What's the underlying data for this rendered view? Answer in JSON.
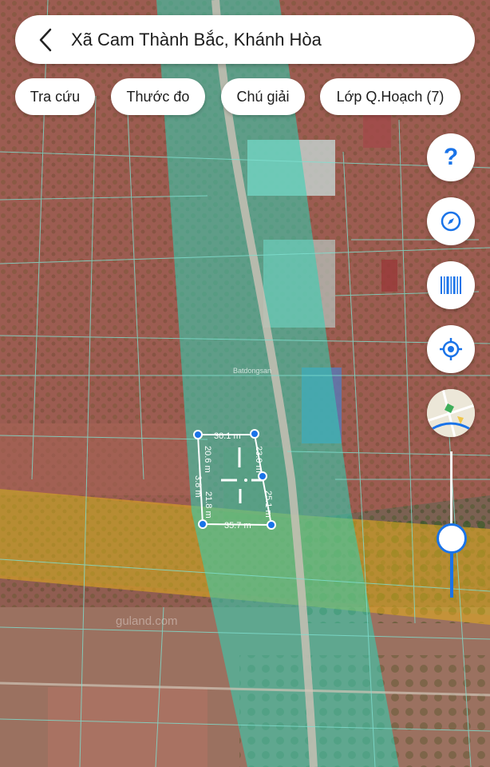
{
  "header": {
    "title": "Xã Cam Thành Bắc, Khánh Hòa"
  },
  "toolbar": {
    "chips": [
      {
        "label": "Tra cứu"
      },
      {
        "label": "Thước đo"
      },
      {
        "label": "Chú giải"
      },
      {
        "label": "Lớp Q.Hoạch (7)"
      }
    ]
  },
  "side_buttons": {
    "help": "?",
    "icons": [
      "help-icon",
      "compass-icon",
      "barcode-icon",
      "location-target-icon"
    ]
  },
  "measurements": {
    "top": "30.1 m",
    "bottom": "35.7 m",
    "left_upper": "20.6 m",
    "left_lower": "3.8 m",
    "left_mid": "21.8 m",
    "right_upper": "23.0 m",
    "right_lower": "25.1 m"
  },
  "watermarks": {
    "center": "Batdongsan",
    "bottom": "guland.com"
  },
  "colors": {
    "accent": "#1a73e8",
    "zone_residential": "#d9534f",
    "zone_transport": "#2ed3b7",
    "zone_agriculture": "#e0a820",
    "parcel_lines": "#7fe0d0"
  }
}
